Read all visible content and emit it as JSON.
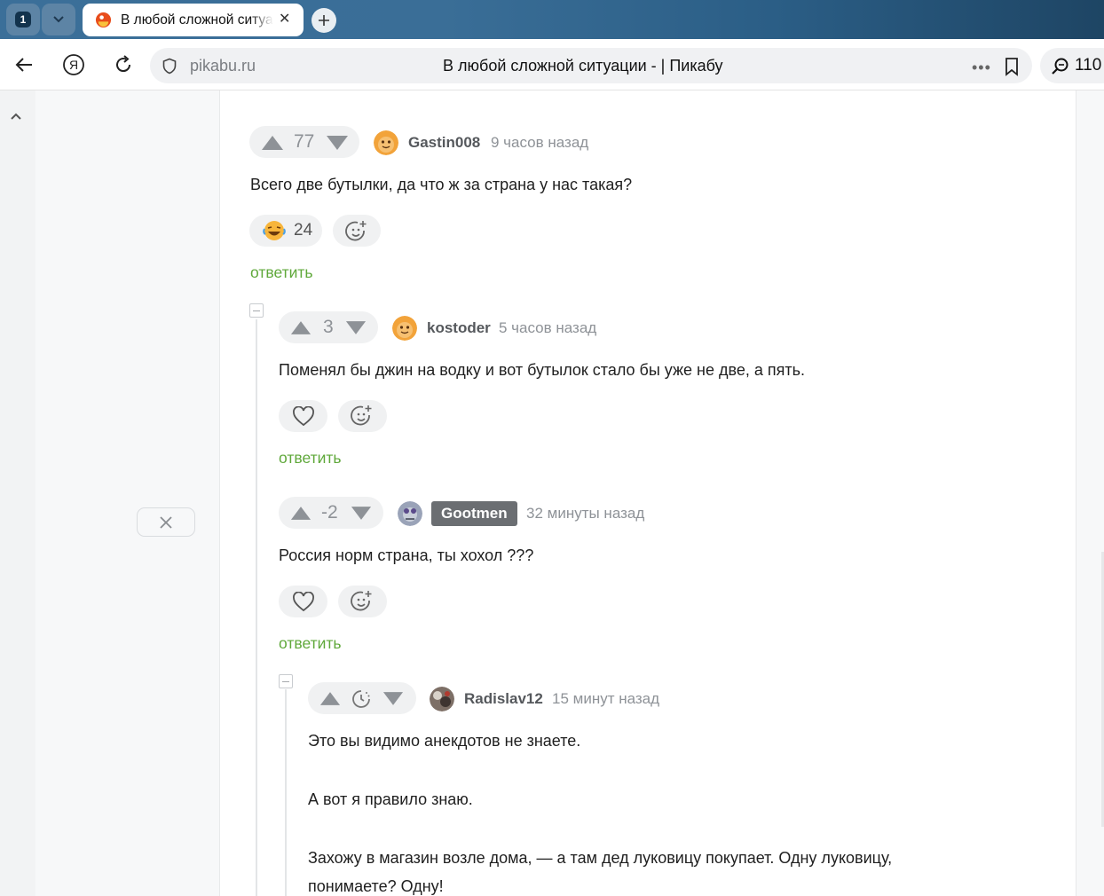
{
  "browser": {
    "tab_count": "1",
    "tab_title": "В любой сложной ситуации - | Пикабу",
    "domain": "pikabu.ru",
    "page_title": "В любой сложной ситуации - | Пикабу",
    "more_label": "•••",
    "search_count": "110"
  },
  "comments": [
    {
      "rating": "77",
      "author": "Gastin008",
      "time": "9 часов назад",
      "text": "Всего две бутылки, да что ж за страна у нас такая?",
      "reaction_count": "24",
      "reply_label": "ответить"
    },
    {
      "rating": "3",
      "author": "kostoder",
      "time": "5 часов назад",
      "text": "Поменял бы джин на водку и вот бутылок стало бы уже не две, а пять.",
      "reply_label": "ответить"
    },
    {
      "rating": "-2",
      "author": "Gootmen",
      "time": "32 минуты назад",
      "text": "Россия норм страна, ты хохол ???",
      "reply_label": "ответить"
    },
    {
      "author": "Radislav12",
      "time": "15 минут назад",
      "text_lines": [
        "Это вы видимо анекдотов не знаете.",
        "А вот я правило знаю.",
        "Захожу в магазин возле дома, — а там дед луковицу покупает. Одну луковицу,",
        "понимаете? Одну!"
      ]
    }
  ],
  "colors": {
    "reply_link": "#5fa83a",
    "badge_bg": "#6b6e72",
    "rating_bg": "#f0f1f2"
  }
}
